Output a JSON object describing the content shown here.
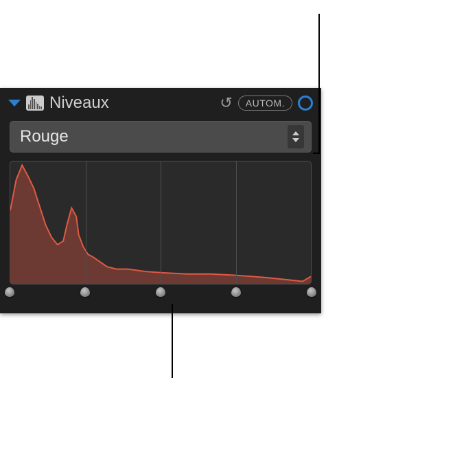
{
  "header": {
    "title": "Niveaux",
    "auto_label": "AUTOM."
  },
  "dropdown": {
    "selected": "Rouge"
  },
  "histogram": {
    "color_stroke": "#e05a44",
    "color_fill": "#6c3a32",
    "grid_positions_pct": [
      25,
      50,
      75
    ],
    "handle_positions_pct": [
      0,
      25,
      50,
      75,
      100
    ]
  },
  "chart_data": {
    "type": "area",
    "title": "",
    "xlabel": "",
    "ylabel": "",
    "xlim": [
      0,
      255
    ],
    "ylim": [
      0,
      100
    ],
    "series": [
      {
        "name": "Rouge",
        "x": [
          0,
          5,
          10,
          15,
          20,
          25,
          30,
          35,
          40,
          45,
          48,
          52,
          56,
          58,
          62,
          66,
          70,
          76,
          82,
          90,
          100,
          115,
          130,
          150,
          170,
          190,
          205,
          218,
          228,
          238,
          248,
          255
        ],
        "values": [
          60,
          85,
          97,
          88,
          78,
          63,
          48,
          38,
          32,
          35,
          48,
          62,
          55,
          40,
          30,
          24,
          22,
          18,
          14,
          12,
          12,
          10,
          9,
          8,
          8,
          7,
          6,
          5,
          4,
          3,
          2,
          6
        ]
      }
    ]
  }
}
